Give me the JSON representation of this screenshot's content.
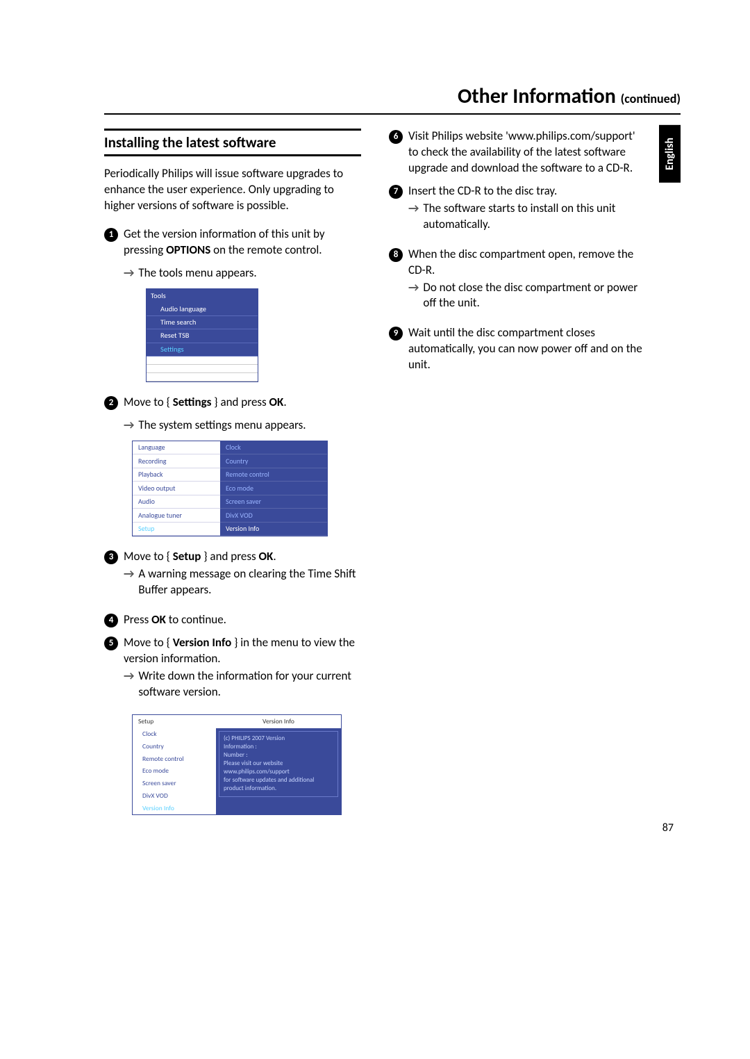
{
  "header": {
    "title": "Other Information",
    "continued": "(continued)"
  },
  "language_tab": "English",
  "page_number": "87",
  "section_heading": "Installing the latest software",
  "intro": "Periodically Philips will issue software upgrades to enhance the user experience. Only upgrading to higher versions of software is possible.",
  "steps_left": {
    "s1": {
      "num": "1",
      "text_a": "Get the version information of this unit by pressing ",
      "bold": "OPTIONS",
      "text_b": " on the remote control.",
      "arrow": "The tools menu appears."
    },
    "s2": {
      "num": "2",
      "text_a": "Move to { ",
      "bold1": "Settings",
      "text_b": " } and press ",
      "bold2": "OK",
      "text_c": ".",
      "arrow": "The system settings menu appears."
    },
    "s3": {
      "num": "3",
      "text_a": "Move to { ",
      "bold1": "Setup",
      "text_b": " } and press ",
      "bold2": "OK",
      "text_c": ".",
      "arrow": "A warning message on clearing the Time Shift Buffer appears."
    },
    "s4": {
      "num": "4",
      "text_a": "Press ",
      "bold": "OK",
      "text_b": " to continue."
    },
    "s5": {
      "num": "5",
      "text_a": "Move to { ",
      "bold1": "Version Info",
      "text_b": " } in the menu to view the version information.",
      "arrow": "Write down the information for your current software version."
    }
  },
  "steps_right": {
    "s6": {
      "num": "6",
      "text": "Visit Philips website 'www.philips.com/support' to check the availability of the latest software upgrade and download the software to a CD-R."
    },
    "s7": {
      "num": "7",
      "text": "Insert the CD-R to the disc tray.",
      "arrow": "The software starts to install on this unit automatically."
    },
    "s8": {
      "num": "8",
      "text": "When the disc compartment open, remove the CD-R.",
      "arrow": "Do not close the disc compartment or power off the unit."
    },
    "s9": {
      "num": "9",
      "text": "Wait until the disc compartment closes automatically, you can now power off and on the unit."
    }
  },
  "fig_tools": {
    "header": "Tools",
    "items": [
      "Audio language",
      "Time search",
      "Reset TSB",
      "Settings"
    ]
  },
  "fig_settings": {
    "left": [
      "Language",
      "Recording",
      "Playback",
      "Video output",
      "Audio",
      "Analogue tuner",
      "Setup"
    ],
    "right": [
      "Clock",
      "Country",
      "Remote control",
      "Eco mode",
      "Screen saver",
      "DivX VOD",
      "Version Info"
    ]
  },
  "fig_version": {
    "left_header": "Setup",
    "right_header": "Version Info",
    "left": [
      "Clock",
      "Country",
      "Remote control",
      "Eco mode",
      "Screen saver",
      "DivX VOD",
      "Version Info"
    ],
    "right_lines": [
      "(c) PHILIPS 2007 Version",
      "Information :",
      "Number :",
      "Please visit our website",
      "www.philips.com/support",
      "for software updates and additional",
      "product information."
    ]
  }
}
